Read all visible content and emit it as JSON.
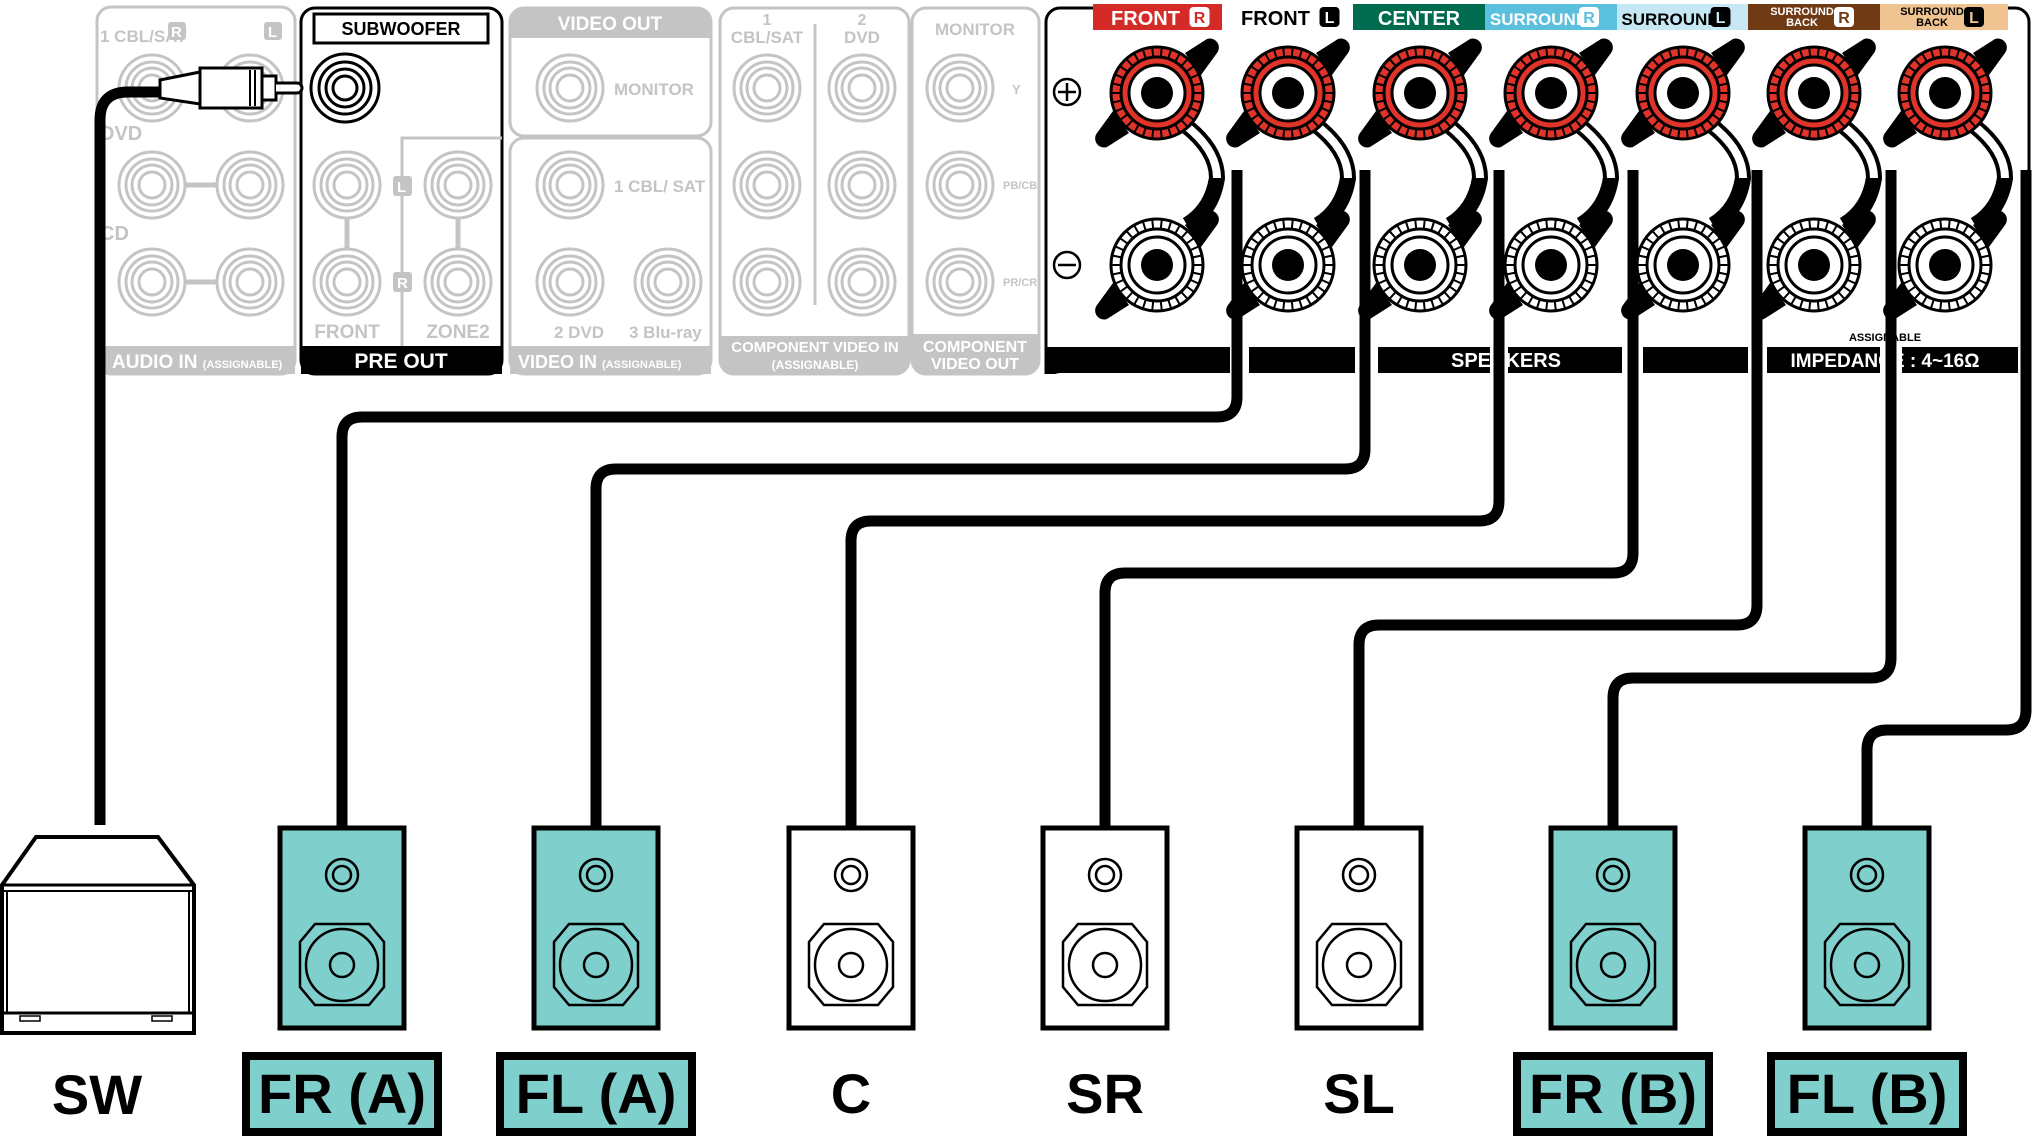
{
  "colors": {
    "inactive_gray": "#c4c4c4",
    "highlight_speaker": "#7fcfcd",
    "front_r": "#d52b27",
    "center": "#006b4e",
    "surround_r": "#5bbfde",
    "surround_l": "#c6e8f4",
    "surround_back_r": "#6f3a14",
    "surround_back_l": "#f0c491",
    "terminal_red": "#e0332a"
  },
  "audio_in": {
    "label": "AUDIO IN",
    "label_small": "(ASSIGNABLE)",
    "rows": [
      "1 CBL/SAT",
      "DVD",
      "CD"
    ],
    "channel_r": "R",
    "channel_l": "L"
  },
  "pre_out": {
    "subwoofer_label": "SUBWOOFER",
    "front_label": "FRONT",
    "zone2_label": "ZONE2",
    "channel_l": "L",
    "channel_r": "R",
    "footer": "PRE OUT"
  },
  "video_out": {
    "header": "VIDEO OUT",
    "monitor": "MONITOR"
  },
  "video_in": {
    "inputs": [
      "1 CBL/ SAT",
      "2 DVD",
      "3 Blu-ray"
    ],
    "footer": "VIDEO IN",
    "footer_small": "(ASSIGNABLE)"
  },
  "component_in": {
    "col1_num": "1",
    "col1": "CBL/SAT",
    "col2_num": "2",
    "col2": "DVD",
    "footer1": "COMPONENT VIDEO IN",
    "footer2": "(ASSIGNABLE)"
  },
  "component_out": {
    "header": "MONITOR",
    "rows": [
      "Y",
      "PB/CB",
      "PR/CR"
    ],
    "footer1": "COMPONENT",
    "footer2": "VIDEO OUT"
  },
  "speakers_panel": {
    "plus": "+",
    "minus": "−",
    "footer_text": "SPEAKERS",
    "assignable": "ASSIGNABLE",
    "impedance": "IMPEDANCE : 4~16Ω",
    "channels": [
      {
        "label": "FRONT",
        "side": "R",
        "style": "front_r"
      },
      {
        "label": "FRONT",
        "side": "L",
        "style": "front_l"
      },
      {
        "label": "CENTER",
        "side": "",
        "style": "center"
      },
      {
        "label": "SURROUND",
        "side": "R",
        "style": "surround_r"
      },
      {
        "label": "SURROUND",
        "side": "L",
        "style": "surround_l"
      },
      {
        "label": "SURROUND BACK",
        "side": "R",
        "style": "surround_back_r"
      },
      {
        "label": "SURROUND BACK",
        "side": "L",
        "style": "surround_back_l"
      }
    ]
  },
  "speakers": [
    {
      "id": "SW",
      "label": "SW",
      "type": "subwoofer",
      "highlighted": false
    },
    {
      "id": "FR_A",
      "label": "FR (A)",
      "type": "bookshelf",
      "highlighted": true,
      "terminal": 0
    },
    {
      "id": "FL_A",
      "label": "FL (A)",
      "type": "bookshelf",
      "highlighted": true,
      "terminal": 1
    },
    {
      "id": "C",
      "label": "C",
      "type": "bookshelf",
      "highlighted": false,
      "terminal": 2
    },
    {
      "id": "SR",
      "label": "SR",
      "type": "bookshelf",
      "highlighted": false,
      "terminal": 3
    },
    {
      "id": "SL",
      "label": "SL",
      "type": "bookshelf",
      "highlighted": false,
      "terminal": 4
    },
    {
      "id": "FR_B",
      "label": "FR (B)",
      "type": "bookshelf",
      "highlighted": true,
      "terminal": 5
    },
    {
      "id": "FL_B",
      "label": "FL (B)",
      "type": "bookshelf",
      "highlighted": true,
      "terminal": 6
    }
  ]
}
